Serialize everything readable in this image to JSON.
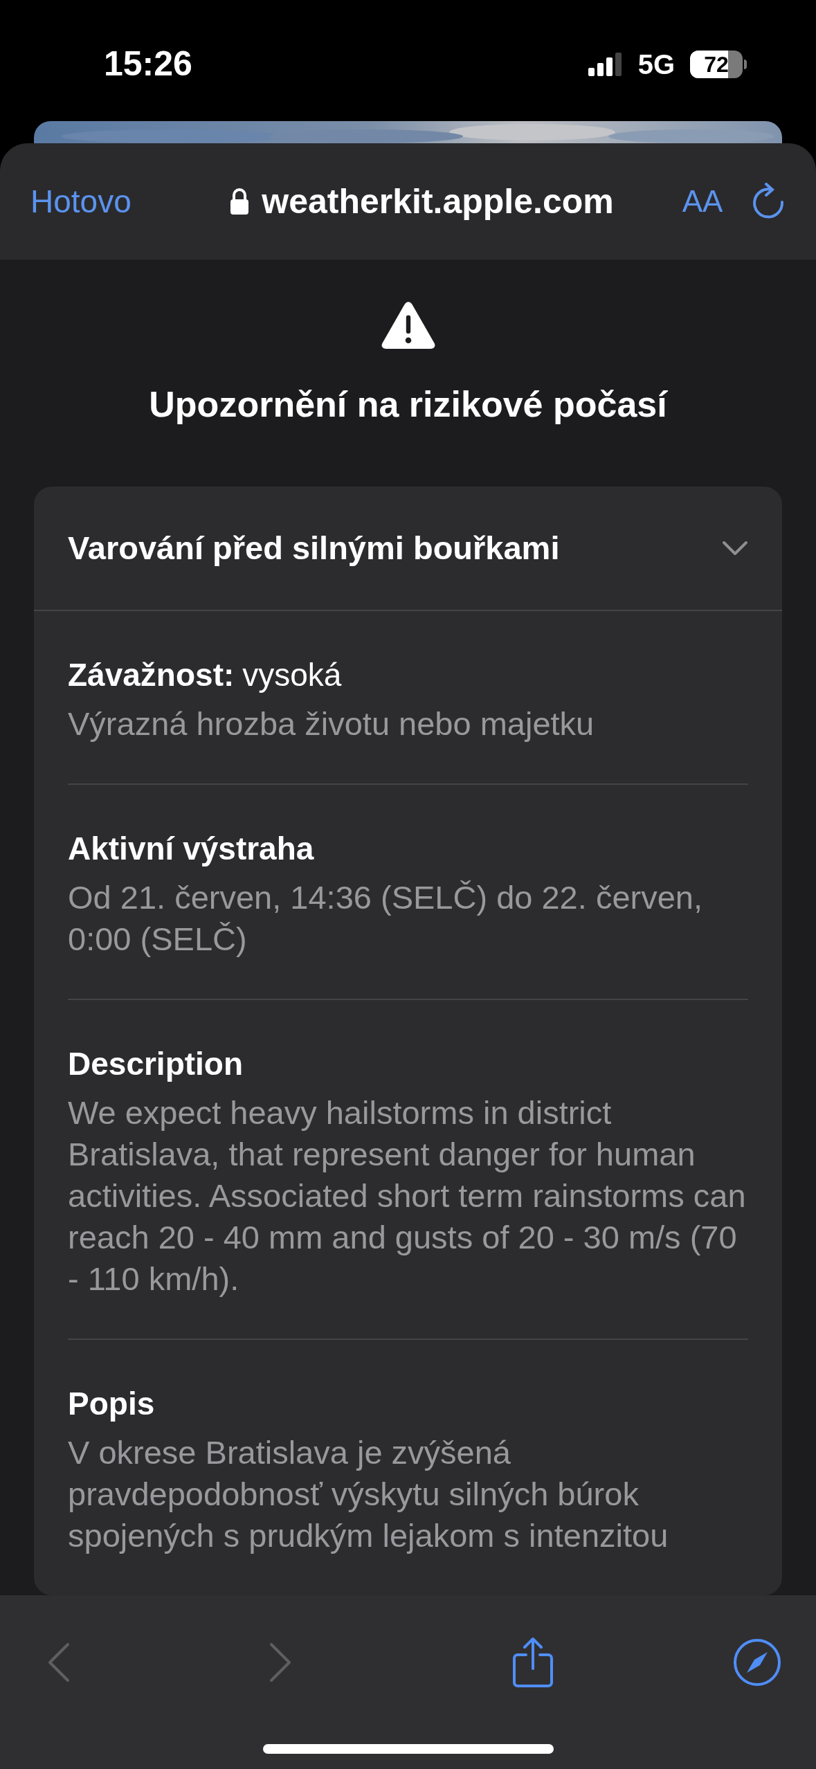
{
  "status_bar": {
    "time": "15:26",
    "network": "5G",
    "battery": "72"
  },
  "browser": {
    "done": "Hotovo",
    "url": "weatherkit.apple.com",
    "text_size": "AA"
  },
  "alert_title": "Upozornění na rizikové počasí",
  "card": {
    "title": "Varování před silnými bouřkami",
    "expanded": false,
    "sections": [
      {
        "heading": "Závažnost:",
        "value": "vysoká",
        "body": "Výrazná hrozba životu nebo majetku"
      },
      {
        "heading": "Aktivní výstraha",
        "body": "Od 21. červen, 14:36 (SELČ) do 22. červen, 0:00 (SELČ)"
      },
      {
        "heading": "Description",
        "body": "We expect heavy hailstorms in district Bratislava, that represent danger for human activities. Associated short term rainstorms can reach 20 - 40 mm and gusts of 20 - 30 m/s (70 - 110 km/h)."
      },
      {
        "heading": "Popis",
        "body": "V okrese Bratislava je zvýšená pravdepodobnosť výskytu silných búrok spojených s prudkým lejakom s intenzitou"
      }
    ]
  },
  "toolbar": {
    "back": {
      "disabled": true
    },
    "forward": {
      "disabled": true
    }
  }
}
